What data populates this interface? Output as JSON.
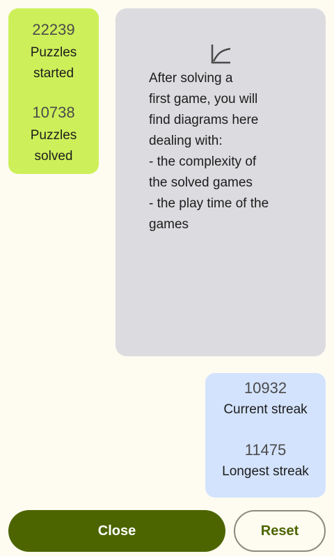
{
  "puzzles": {
    "started_count": "22239",
    "started_label": "Puzzles\nstarted",
    "solved_count": "10738",
    "solved_label": "Puzzles\nsolved"
  },
  "streaks": {
    "current_count": "10932",
    "current_label": "Current streak",
    "longest_count": "11475",
    "longest_label": "Longest streak"
  },
  "diagram": {
    "icon": "chart-line-icon",
    "message": "After solving a\nfirst game, you will\nfind diagrams here\ndealing with:\n- the complexity of\nthe solved games\n- the play time of the\ngames"
  },
  "buttons": {
    "close_label": "Close",
    "reset_label": "Reset"
  },
  "colors": {
    "background": "#fefbf1",
    "puzzles_card": "#cdf05a",
    "streaks_card": "#d3e3fd",
    "diagram_card": "#dcdbdf",
    "primary": "#4c6500"
  }
}
